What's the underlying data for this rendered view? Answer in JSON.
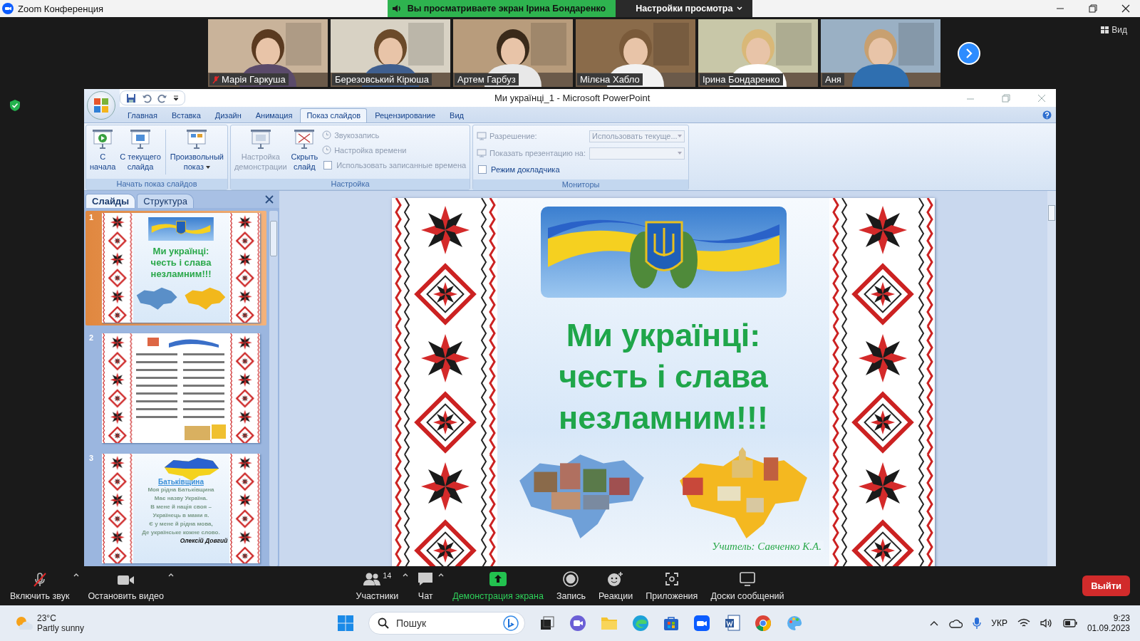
{
  "window": {
    "title": "Zoom Конференция"
  },
  "share_banner": {
    "text": "Вы просматриваете экран Ірина Бондаренко",
    "view_options": "Настройки просмотра"
  },
  "participants": [
    {
      "name": "Марія Гаркуша",
      "muted": true
    },
    {
      "name": "Березовський Кірюша",
      "muted": false
    },
    {
      "name": "Артем Гарбуз",
      "muted": false
    },
    {
      "name": "Мілєна Хабло",
      "muted": false
    },
    {
      "name": "Ірина Бондаренко",
      "muted": false
    },
    {
      "name": "Аня",
      "muted": false
    }
  ],
  "view_button": "Вид",
  "powerpoint": {
    "title": "Ми українці_1 - Microsoft PowerPoint",
    "tabs": [
      {
        "label": "Главная",
        "selected": false
      },
      {
        "label": "Вставка",
        "selected": false
      },
      {
        "label": "Дизайн",
        "selected": false
      },
      {
        "label": "Анимация",
        "selected": false
      },
      {
        "label": "Показ слайдов",
        "selected": true
      },
      {
        "label": "Рецензирование",
        "selected": false
      },
      {
        "label": "Вид",
        "selected": false
      }
    ],
    "groups": [
      {
        "label": "Начать показ слайдов",
        "items": [
          {
            "kind": "large",
            "label_lines": [
              "С",
              "начала"
            ],
            "disabled": false,
            "menu": false
          },
          {
            "kind": "large",
            "label_lines": [
              "С текущего",
              "слайда"
            ],
            "disabled": false,
            "menu": false
          },
          {
            "kind": "large",
            "label_lines": [
              "Произвольный",
              "показ"
            ],
            "disabled": false,
            "menu": true
          }
        ]
      },
      {
        "label": "Настройка",
        "items": [
          {
            "kind": "large",
            "label_lines": [
              "Настройка",
              "демонстрации"
            ],
            "disabled": true,
            "menu": false
          },
          {
            "kind": "large",
            "label_lines": [
              "Скрыть",
              "слайд"
            ],
            "disabled": false,
            "menu": false
          },
          {
            "kind": "small",
            "label": "Звукозапись",
            "disabled": true
          },
          {
            "kind": "small",
            "label": "Настройка времени",
            "disabled": true
          },
          {
            "kind": "checkbox",
            "label": "Использовать записанные времена",
            "checked": false,
            "disabled": true
          }
        ]
      },
      {
        "label": "Мониторы",
        "items": [
          {
            "kind": "dropdown",
            "label": "Разрешение:",
            "value": "Использовать текуще...",
            "disabled": true
          },
          {
            "kind": "dropdown",
            "label": "Показать презентацию на:",
            "disabled": true
          },
          {
            "kind": "checkbox",
            "label": "Режим докладчика",
            "checked": false,
            "disabled": false
          }
        ]
      }
    ],
    "pane_tabs": [
      {
        "label": "Слайды",
        "selected": true
      },
      {
        "label": "Структура",
        "selected": false
      }
    ],
    "slides": [
      {
        "number": "1",
        "selected": true,
        "kind": "title",
        "title_lines": [
          "Ми українці:",
          "честь і слава",
          "незламним!!!"
        ]
      },
      {
        "number": "2",
        "selected": false,
        "kind": "picture"
      },
      {
        "number": "3",
        "selected": false,
        "kind": "poem",
        "heading": "Батьківщина",
        "lines": [
          "Моя рідна Батьківщина",
          "Має назву Україна.",
          "В мене й нація своя –",
          "Українець в мами я.",
          "Є у мене й рідна мова,",
          "Де українське кожне слово."
        ],
        "author": "Олексій Довгий"
      }
    ],
    "slide": {
      "title_lines": [
        "Ми українці:",
        "честь і слава",
        "незламним!!!"
      ],
      "teacher": "Учитель: Савченко К.А."
    }
  },
  "toolbar": {
    "left": [
      {
        "kind": "mic",
        "label": "Включить звук",
        "muted": true
      },
      {
        "kind": "video",
        "label": "Остановить видео",
        "muted": false
      }
    ],
    "center": [
      {
        "kind": "participants",
        "label": "Участники",
        "count": "14",
        "active": false
      },
      {
        "kind": "chat",
        "label": "Чат",
        "active": false
      },
      {
        "kind": "share",
        "label": "Демонстрация экрана",
        "active": true
      },
      {
        "kind": "record",
        "label": "Запись",
        "active": false
      },
      {
        "kind": "reactions",
        "label": "Реакции",
        "active": false
      },
      {
        "kind": "apps",
        "label": "Приложения",
        "active": false
      },
      {
        "kind": "whiteboards",
        "label": "Доски сообщений",
        "active": false
      }
    ],
    "leave": "Выйти"
  },
  "taskbar": {
    "weather": {
      "temperature": "23°C",
      "condition": "Partly sunny"
    },
    "search": {
      "placeholder": "Пошук"
    },
    "language": "УКР",
    "time": "9:23",
    "date": "01.09.2023"
  }
}
